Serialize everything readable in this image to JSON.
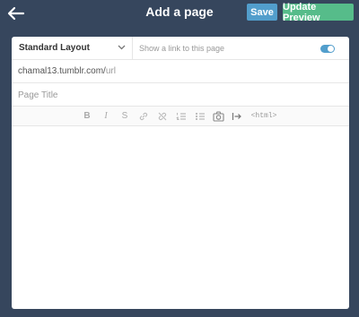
{
  "header": {
    "title": "Add a page",
    "save_label": "Save",
    "preview_label": "Update Preview"
  },
  "layout": {
    "selected": "Standard Layout"
  },
  "link": {
    "text": "Show a link to this page",
    "enabled": true
  },
  "url": {
    "base": "chamal13.tumblr.com/",
    "path_placeholder": "url"
  },
  "page_title": {
    "placeholder": "Page Title",
    "value": ""
  },
  "toolbar": {
    "bold": "B",
    "italic": "I",
    "strike": "S",
    "html": "<html>"
  },
  "colors": {
    "background": "#36465d",
    "save": "#529ecc",
    "preview": "#56bc8a",
    "toggle": "#529ecc"
  },
  "icons": [
    "back-arrow-icon",
    "chevron-down-icon",
    "bold-icon",
    "italic-icon",
    "strikethrough-icon",
    "link-icon",
    "unlink-icon",
    "ordered-list-icon",
    "unordered-list-icon",
    "camera-icon",
    "read-more-icon",
    "html-icon"
  ]
}
